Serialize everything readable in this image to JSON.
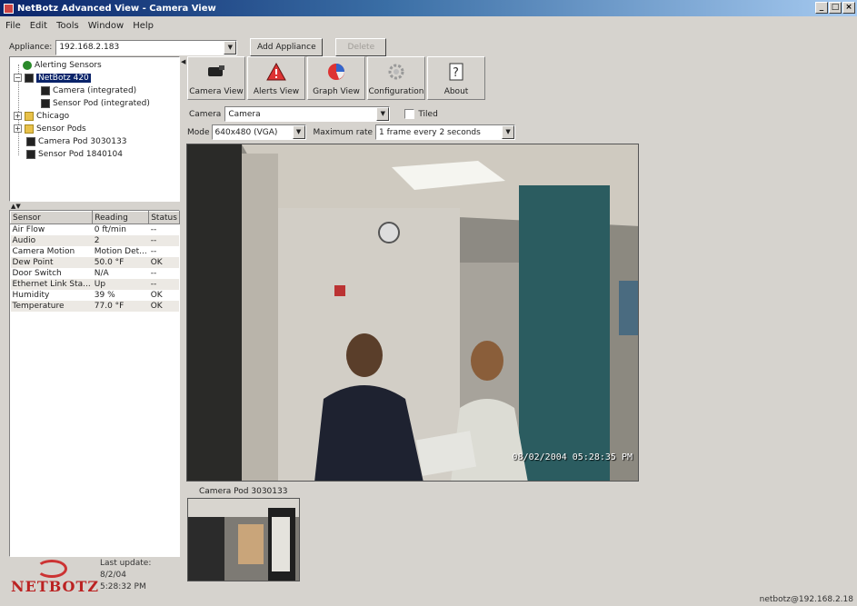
{
  "window": {
    "title": "NetBotz Advanced View - Camera View",
    "buttons": [
      "_",
      "□",
      "×"
    ]
  },
  "menu": [
    "File",
    "Edit",
    "Tools",
    "Window",
    "Help"
  ],
  "appliance": {
    "label": "Appliance:",
    "value": "192.168.2.183",
    "add_button": "Add Appliance",
    "disabled_button": "Delete"
  },
  "tree": {
    "alerting": "Alerting Sensors",
    "netbotz": "NetBotz 420",
    "camera_integrated": "Camera (integrated)",
    "sensor_pod_integrated": "Sensor Pod (integrated)",
    "chicago": "Chicago",
    "sensor_pods": "Sensor Pods",
    "camera_pod": "Camera Pod 3030133",
    "sensor_pod": "Sensor Pod 1840104"
  },
  "sensor_table": {
    "headers": [
      "Sensor",
      "Reading",
      "Status"
    ],
    "rows": [
      [
        "Air Flow",
        "0 ft/min",
        "--"
      ],
      [
        "Audio",
        "2",
        "--"
      ],
      [
        "Camera Motion",
        "Motion Det...",
        "--"
      ],
      [
        "Dew Point",
        "50.0 °F",
        "OK"
      ],
      [
        "Door Switch",
        "N/A",
        "--"
      ],
      [
        "Ethernet Link Sta...",
        "Up",
        "--"
      ],
      [
        "Humidity",
        "39 %",
        "OK"
      ],
      [
        "Temperature",
        "77.0 °F",
        "OK"
      ]
    ]
  },
  "logo": {
    "text": "NETBOTZ"
  },
  "last_update": {
    "label": "Last update:",
    "date": "8/2/04",
    "time": "5:28:32 PM"
  },
  "toolbar": {
    "camera_view": "Camera View",
    "alerts_view": "Alerts View",
    "graph_view": "Graph View",
    "configuration": "Configuration",
    "about": "About"
  },
  "camera_controls": {
    "camera_label": "Camera",
    "camera_value": "Camera",
    "tiled_label": "Tiled",
    "mode_label": "Mode",
    "mode_value": "640x480 (VGA)",
    "rate_label": "Maximum rate",
    "rate_value": "1 frame every 2 seconds"
  },
  "camera_image": {
    "timestamp": "08/02/2004 05:28:35 PM"
  },
  "camera_pod": {
    "label": "Camera Pod 3030133"
  },
  "status_bar": {
    "text": "netbotz@192.168.2.18"
  }
}
